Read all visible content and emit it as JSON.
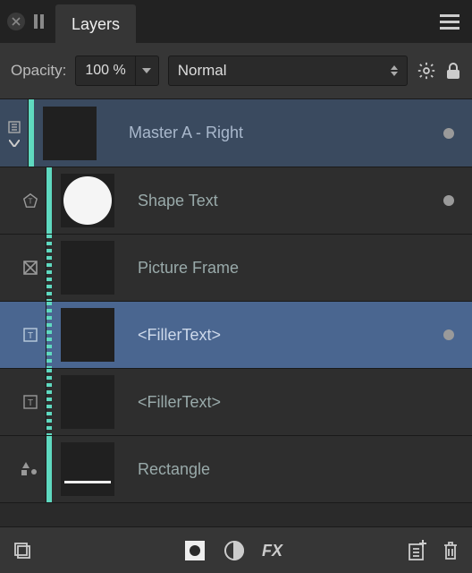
{
  "tab_title": "Layers",
  "toolbar": {
    "opacity_label": "Opacity:",
    "opacity_value": "100 %",
    "blend_mode": "Normal"
  },
  "layers": [
    {
      "name": "Master A - Right",
      "kind": "master",
      "visible": true
    },
    {
      "name": "Shape Text",
      "kind": "shape-text",
      "thumb": "circle",
      "visible": true
    },
    {
      "name": "Picture Frame",
      "kind": "picture-frame",
      "thumb": "blank",
      "visible": false
    },
    {
      "name": "<FillerText>",
      "kind": "text-frame",
      "thumb": "blank",
      "selected": true,
      "visible": true
    },
    {
      "name": "<FillerText>",
      "kind": "text-frame",
      "thumb": "blank",
      "visible": false
    },
    {
      "name": "Rectangle",
      "kind": "rectangle",
      "thumb": "line",
      "visible": false
    }
  ]
}
